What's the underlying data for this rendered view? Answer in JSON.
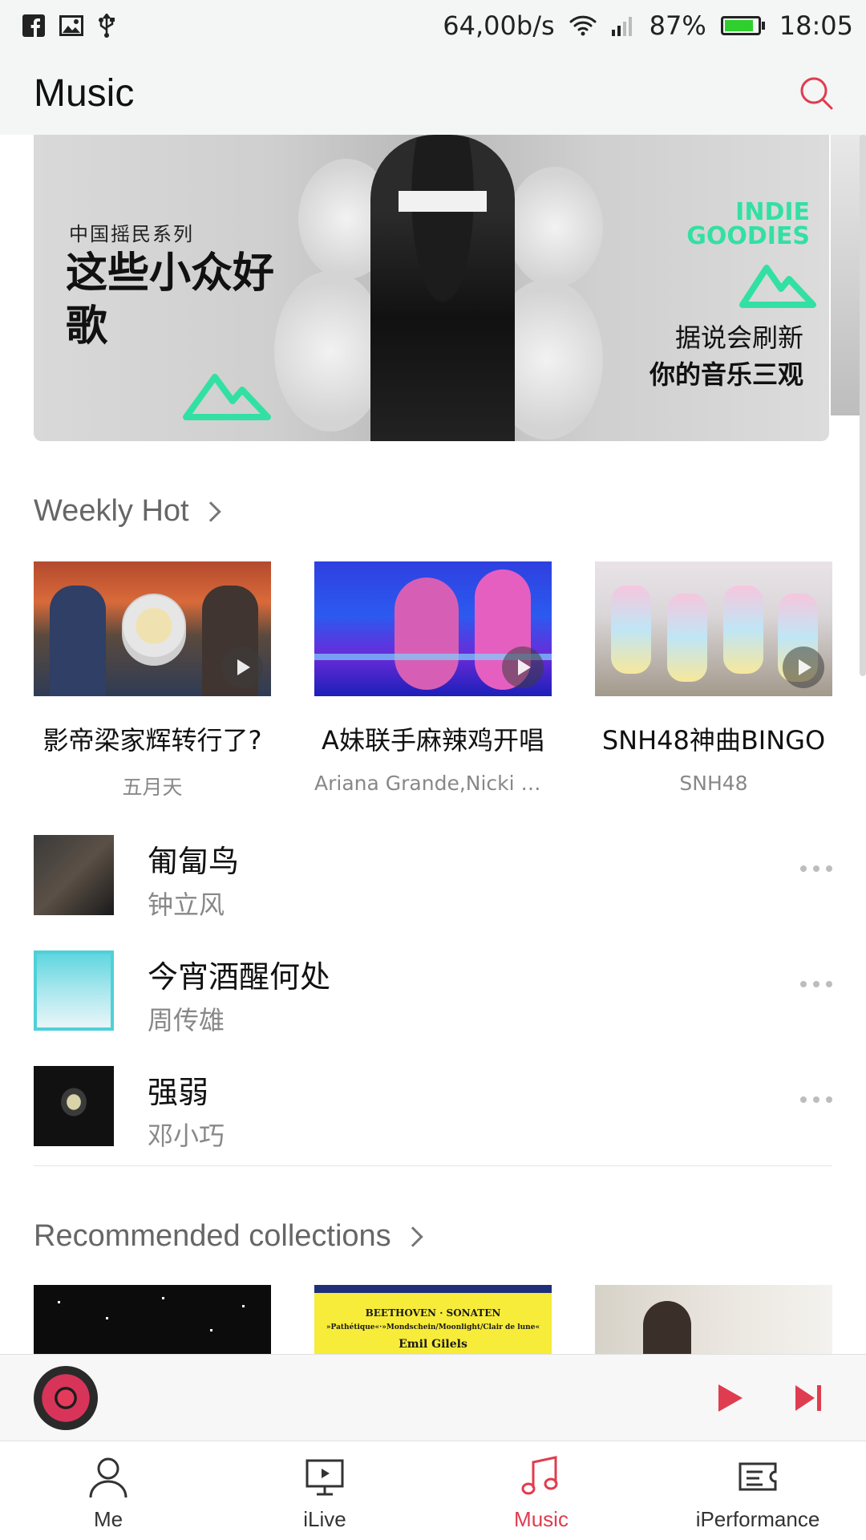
{
  "status_bar": {
    "speed": "64,00b/s",
    "battery_percent": "87%",
    "battery_level": 0.87,
    "time": "18:05",
    "left_icons": [
      "facebook-icon",
      "image-icon",
      "usb-icon"
    ],
    "right_icons": [
      "wifi-icon",
      "signal-icon",
      "battery-icon"
    ]
  },
  "header": {
    "title": "Music",
    "search_icon": "search-icon",
    "accent_color": "#e03c4f"
  },
  "banner": {
    "kicker": "中国摇民系列",
    "headline": "这些小众好歌",
    "brand": "INDIE GOODIES",
    "subline1": "据说会刷新",
    "subline2": "你的音乐三观",
    "brand_color": "#33e0a4"
  },
  "weekly_hot": {
    "title": "Weekly Hot",
    "videos": [
      {
        "title": "影帝梁家辉转行了?",
        "artist": "五月天"
      },
      {
        "title": "A妹联手麻辣鸡开唱",
        "artist": "Ariana Grande,Nicki Mi…"
      },
      {
        "title": "SNH48神曲BINGO",
        "artist": "SNH48"
      }
    ]
  },
  "songs": [
    {
      "title": "匍匐鸟",
      "artist": "钟立风"
    },
    {
      "title": "今宵酒醒何处",
      "artist": "周传雄"
    },
    {
      "title": "强弱",
      "artist": "邓小巧"
    }
  ],
  "recommended": {
    "title": "Recommended collections",
    "album_text": {
      "line1": "BEETHOVEN · SONATEN",
      "line2": "»Pathétique«·»Mondschein/Moonlight/Clair de lune«",
      "line3": "Emil Gilels"
    }
  },
  "player": {
    "play_icon": "play-icon",
    "next_icon": "skip-next-icon"
  },
  "nav": {
    "items": [
      {
        "label": "Me",
        "icon": "person-icon"
      },
      {
        "label": "iLive",
        "icon": "tv-icon"
      },
      {
        "label": "Music",
        "icon": "music-note-icon",
        "active": true
      },
      {
        "label": "iPerformance",
        "icon": "ticket-icon"
      }
    ]
  }
}
